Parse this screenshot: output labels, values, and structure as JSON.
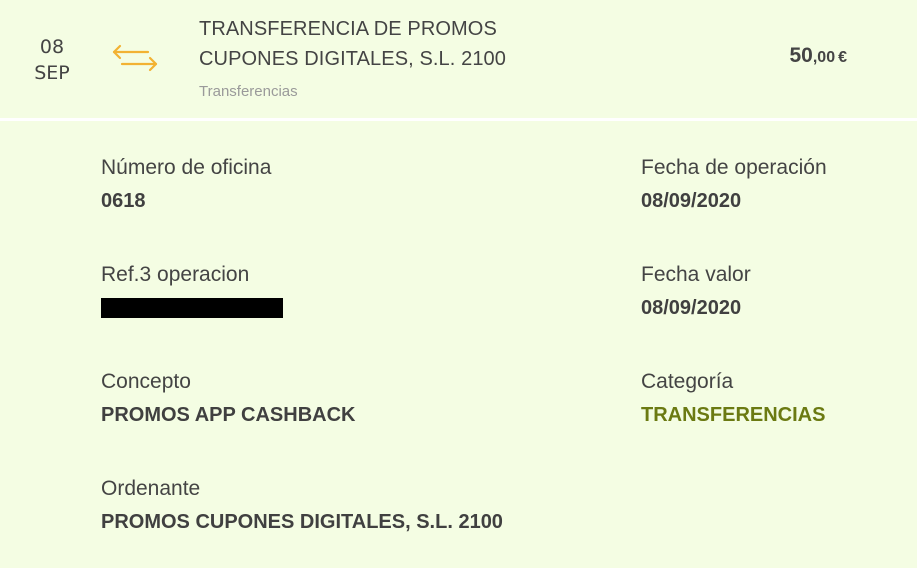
{
  "transaction": {
    "day": "08",
    "month": "SEP",
    "title_line1": "TRANSFERENCIA DE PROMOS",
    "title_line2": "CUPONES DIGITALES, S.L. 2100",
    "category_sub": "Transferencias",
    "amount_int": "50",
    "amount_dec": ",00",
    "currency": "€"
  },
  "details": {
    "office_label": "Número de oficina",
    "office_value": "0618",
    "op_date_label": "Fecha de operación",
    "op_date_value": "08/09/2020",
    "ref_label": "Ref.3 operacion",
    "value_date_label": "Fecha valor",
    "value_date_value": "08/09/2020",
    "concept_label": "Concepto",
    "concept_value": "PROMOS APP CASHBACK",
    "category_label": "Categoría",
    "category_value": "TRANSFERENCIAS",
    "ordering_label": "Ordenante",
    "ordering_value": "PROMOS CUPONES DIGITALES, S.L. 2100"
  },
  "colors": {
    "background": "#f4fde3",
    "icon": "#f2b233",
    "category": "#6b7a12"
  },
  "icons": {
    "transfer": "transfer-arrows-icon"
  }
}
